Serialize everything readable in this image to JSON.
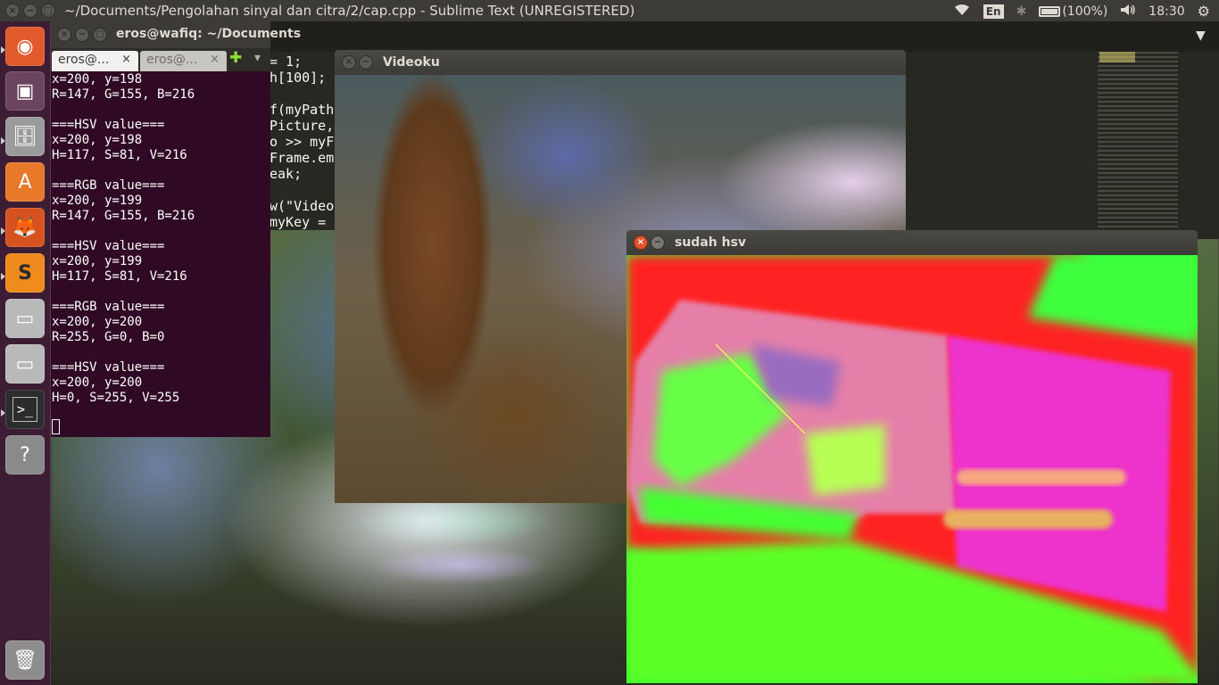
{
  "top_panel": {
    "title": "~/Documents/Pengolahan sinyal dan citra/2/cap.cpp - Sublime Text (UNREGISTERED)",
    "language": "En",
    "battery_text": "(100%)",
    "time": "18:30",
    "close_glyph": "×",
    "minimize_glyph": "−",
    "maximize_glyph": "□"
  },
  "launcher": {
    "items": [
      {
        "name": "dash",
        "glyph": "◉",
        "color": "#e05a2b"
      },
      {
        "name": "workspaces",
        "glyph": "▣",
        "color": "#6b4560"
      },
      {
        "name": "files",
        "glyph": "🗄",
        "color": "#9b9b9b"
      },
      {
        "name": "software-center",
        "glyph": "A",
        "color": "#e8792b"
      },
      {
        "name": "firefox",
        "glyph": "🦊",
        "color": "#d6521f"
      },
      {
        "name": "sublime-text",
        "glyph": "S",
        "color": "#ef8b1c"
      },
      {
        "name": "drive-1",
        "glyph": "▭",
        "color": "#b9b9b9"
      },
      {
        "name": "drive-2",
        "glyph": "▭",
        "color": "#b9b9b9"
      },
      {
        "name": "terminal",
        "glyph": ">_",
        "color": "#2c2c2c"
      },
      {
        "name": "help",
        "glyph": "?",
        "color": "#8a8a8a"
      }
    ],
    "trash_glyph": "🗑"
  },
  "sublime": {
    "code_lines": [
      "= 1;",
      "h[100];",
      "",
      "f(myPath",
      "Picture,",
      "o >> myF",
      "Frame.em",
      "eak;",
      "",
      "w(\"Video",
      "myKey ="
    ],
    "menu_arrow": "▼"
  },
  "terminal": {
    "title": "eros@wafiq: ~/Documents",
    "tabs": [
      {
        "label": "eros@...",
        "close": "×"
      },
      {
        "label": "eros@...",
        "close": "×"
      }
    ],
    "add_tab_glyph": "✚",
    "tab_menu_glyph": "▾",
    "lines": [
      "x=200, y=198",
      "R=147, G=155, B=216",
      "",
      "===HSV value===",
      "x=200, y=198",
      "H=117, S=81, V=216",
      "",
      "===RGB value===",
      "x=200, y=199",
      "R=147, G=155, B=216",
      "",
      "===HSV value===",
      "x=200, y=199",
      "H=117, S=81, V=216",
      "",
      "===RGB value===",
      "x=200, y=200",
      "R=255, G=0, B=0",
      "",
      "===HSV value===",
      "x=200, y=200",
      "H=0, S=255, V=255"
    ]
  },
  "videoku": {
    "title": "Videoku"
  },
  "sudah_hsv": {
    "title": "sudah hsv"
  }
}
